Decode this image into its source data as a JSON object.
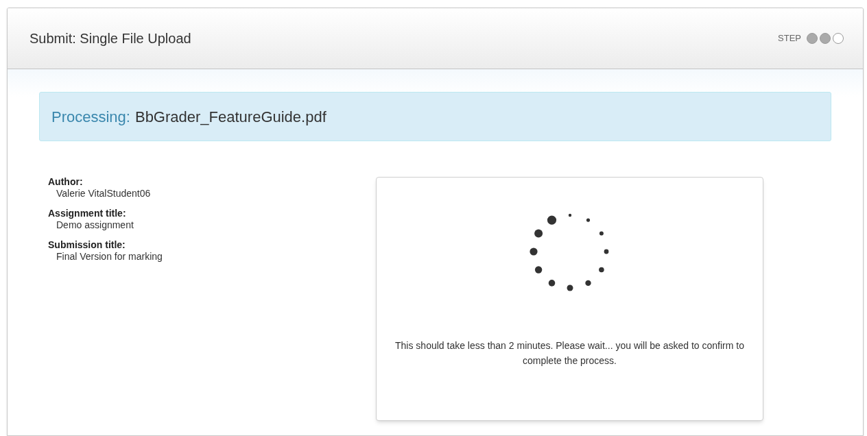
{
  "window": {
    "title": "Submit: Single File Upload",
    "step_label": "STEP",
    "steps": [
      {
        "done": true
      },
      {
        "done": true
      },
      {
        "done": false
      }
    ]
  },
  "banner": {
    "label": "Processing:",
    "file_name": "BbGrader_FeatureGuide.pdf"
  },
  "details": [
    {
      "label": "Author:",
      "value": "Valerie VitalStudent06"
    },
    {
      "label": "Assignment title:",
      "value": "Demo assignment"
    },
    {
      "label": "Submission title:",
      "value": "Final Version for marking"
    }
  ],
  "progress_card": {
    "message": "This should take less than 2 minutes. Please wait... you will be asked to confirm to complete the process."
  }
}
